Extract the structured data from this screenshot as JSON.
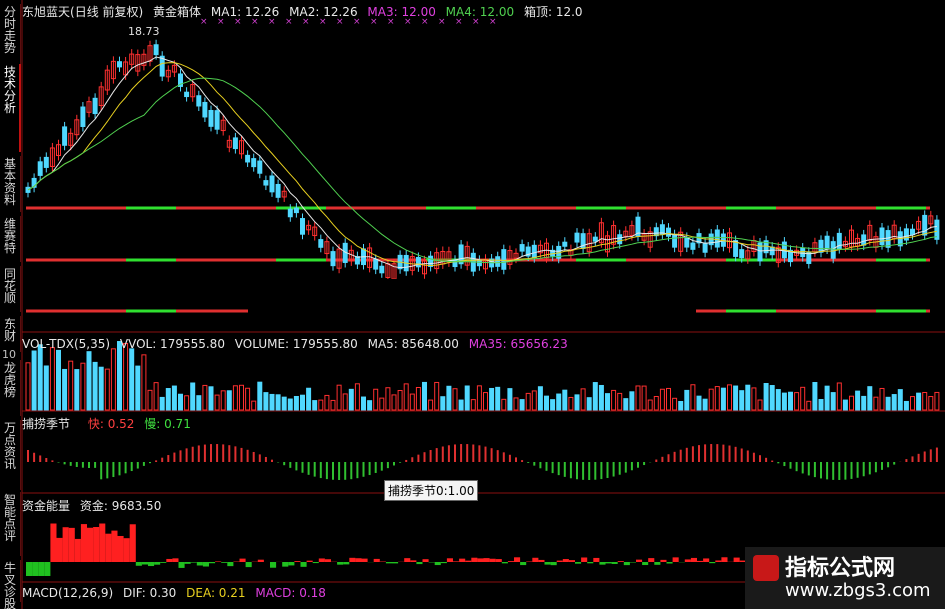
{
  "stock": {
    "name": "东旭蓝天",
    "period": "(日线 前复权)",
    "indicator": "黄金箱体"
  },
  "ma": [
    {
      "label": "MA1:",
      "value": "12.26",
      "color": "#e8e8e8"
    },
    {
      "label": "MA2:",
      "value": "12.26",
      "color": "#e8e8e8"
    },
    {
      "label": "MA3:",
      "value": "12.00",
      "color": "#e040e0"
    },
    {
      "label": "MA4:",
      "value": "12.00",
      "color": "#50d050"
    },
    {
      "label": "箱顶:",
      "value": "12.0",
      "color": "#e8e8e8"
    }
  ],
  "peak_label": "18.73",
  "side_tabs": [
    {
      "label": "分时走势",
      "selected": false
    },
    {
      "label": "技术分析",
      "selected": true
    },
    {
      "label": "基本资料",
      "selected": false
    },
    {
      "label": "维赛特",
      "selected": false
    },
    {
      "label": "同花顺",
      "selected": false
    },
    {
      "label": "东财",
      "selected": false
    },
    {
      "label": "龙虎榜",
      "selected": false
    },
    {
      "label": "万点资讯",
      "selected": false
    },
    {
      "label": "智能点评",
      "selected": false
    },
    {
      "label": "牛叉诊股",
      "selected": false
    }
  ],
  "vol_panel": {
    "name": "VOL-TDX(5,35)",
    "vvol": "VVOL: 179555.80",
    "volume": "VOLUME: 179555.80",
    "ma5": "MA5: 85648.00",
    "ma35": "MA35: 65656.23",
    "axis_label": "10"
  },
  "season_panel": {
    "name": "捕捞季节",
    "fast": "快: 0.52",
    "slow": "慢: 0.71"
  },
  "tooltip": "捕捞季节0:1.00",
  "fund_panel": {
    "name": "资金能量",
    "value": "资金: 9683.50"
  },
  "macd_panel": {
    "name": "MACD(12,26,9)",
    "dif": "DIF: 0.30",
    "dea": "DEA: 0.21",
    "macd": "MACD: 0.18"
  },
  "watermark": {
    "title": "指标公式网",
    "url": "www.zbgs3.com"
  },
  "colors": {
    "up": "#ff3030",
    "down": "#50d8ff",
    "box_red": "#e03030",
    "box_green": "#30e030",
    "ma_white": "#e8e8e8",
    "ma_yellow": "#e8d020",
    "ma_green": "#50d050",
    "ma_purple": "#d040d0"
  }
}
